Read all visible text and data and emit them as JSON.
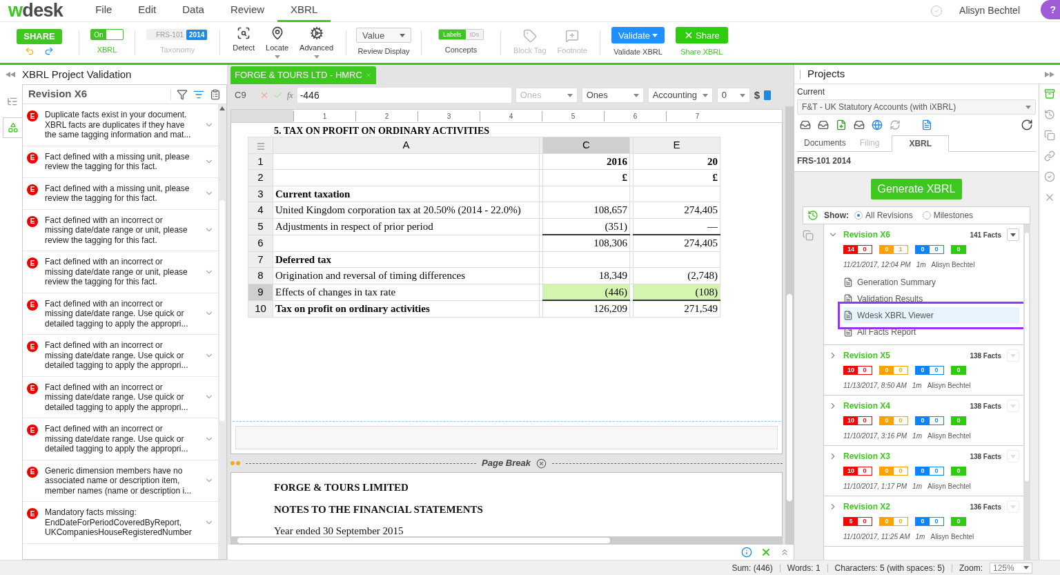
{
  "logo": {
    "accent": "w",
    "rest": "desk"
  },
  "menu": [
    {
      "label": "File",
      "selected": false
    },
    {
      "label": "Edit",
      "selected": false
    },
    {
      "label": "Data",
      "selected": false
    },
    {
      "label": "Review",
      "selected": false
    },
    {
      "label": "XBRL",
      "selected": true
    }
  ],
  "user": "Alisyn Bechtel",
  "help": "?",
  "toolbar": {
    "share": "SHARE",
    "xbrl_toggle": {
      "on": true,
      "text": "On",
      "label": "XBRL"
    },
    "taxonomy": {
      "name": "FRS-101",
      "year": "2014",
      "label": "Taxonomy"
    },
    "tools": [
      {
        "kind": "detect",
        "label": "Detect",
        "menu": false
      },
      {
        "kind": "locate",
        "label": "Locate",
        "menu": true
      },
      {
        "kind": "advanced",
        "label": "Advanced",
        "menu": true
      }
    ],
    "review_display": {
      "value": "Value",
      "label": "Review Display"
    },
    "concepts": {
      "options": [
        {
          "label": "Labels",
          "selected": true
        },
        {
          "label": "IDs",
          "selected": false
        }
      ],
      "label": "Concepts"
    },
    "tag_tools": [
      {
        "kind": "tag",
        "label": "Block Tag",
        "disabled": true
      },
      {
        "kind": "footnote",
        "label": "Footnote",
        "disabled": true
      }
    ],
    "validate": {
      "button": "Validate",
      "label": "Validate XBRL"
    },
    "share_xbrl": {
      "button": "Share",
      "label": "Share XBRL"
    }
  },
  "validation_panel": {
    "title": "XBRL Project Validation",
    "left_rail": [
      {
        "kind": "outline",
        "selected": false
      },
      {
        "kind": "shapes",
        "selected": true
      }
    ],
    "revision": "Revision X6",
    "issues": [
      {
        "severity": "E",
        "lines": [
          "Duplicate facts exist in your document.",
          "XBRL facts are duplicates if they have",
          "the same tagging information and mat..."
        ]
      },
      {
        "severity": "E",
        "lines": [
          "Fact defined with a missing unit, please",
          "review the tagging for this fact."
        ]
      },
      {
        "severity": "E",
        "lines": [
          "Fact defined with a missing unit, please",
          "review the tagging for this fact."
        ]
      },
      {
        "severity": "E",
        "lines": [
          "Fact defined with an incorrect or",
          "missing date/date range or unit, please",
          "review the tagging for this fact."
        ]
      },
      {
        "severity": "E",
        "lines": [
          "Fact defined with an incorrect or",
          "missing date/date range or unit, please",
          "review the tagging for this fact."
        ]
      },
      {
        "severity": "E",
        "lines": [
          "Fact defined with an incorrect or",
          "missing date/date range. Use quick or",
          "detailed tagging to apply the appropri..."
        ]
      },
      {
        "severity": "E",
        "lines": [
          "Fact defined with an incorrect or",
          "missing date/date range. Use quick or",
          "detailed tagging to apply the appropri..."
        ]
      },
      {
        "severity": "E",
        "lines": [
          "Fact defined with an incorrect or",
          "missing date/date range. Use quick or",
          "detailed tagging to apply the appropri..."
        ]
      },
      {
        "severity": "E",
        "lines": [
          "Fact defined with an incorrect or",
          "missing date/date range. Use quick or",
          "detailed tagging to apply the appropri..."
        ]
      },
      {
        "severity": "E",
        "lines": [
          "Generic dimension members have no",
          "associated name or description item,",
          "member names (name or description i..."
        ]
      },
      {
        "severity": "E",
        "lines": [
          "Mandatory facts missing:",
          "EndDateForPeriodCoveredByReport,",
          "UKCompaniesHouseRegisteredNumber"
        ]
      }
    ]
  },
  "document": {
    "tab": "FORGE & TOURS LTD - HMRC",
    "formula_bar": {
      "cell": "C9",
      "function_label": "fx",
      "value": "-446",
      "selects": [
        {
          "value": "Ones",
          "disabled": true
        },
        {
          "value": "Ones",
          "disabled": false
        },
        {
          "value": "Accounting",
          "disabled": false
        },
        {
          "value": "0",
          "disabled": false
        }
      ],
      "currency": "$"
    },
    "ruler": [
      "1",
      "2",
      "3",
      "4",
      "5",
      "6",
      "7"
    ],
    "heading": "5. TAX ON PROFIT ON ORDINARY ACTIVITIES",
    "columns": [
      {
        "kind": "wide",
        "label": "A",
        "selected": false
      },
      {
        "kind": "narrow"
      },
      {
        "kind": "wide",
        "label": "C",
        "selected": true
      },
      {
        "kind": "narrow"
      },
      {
        "kind": "wide",
        "label": "E",
        "selected": false
      }
    ],
    "rows": [
      {
        "num": "1",
        "selected": false,
        "values_bold": true,
        "c": "2016",
        "e": "20"
      },
      {
        "num": "2",
        "selected": false,
        "values_bold": true,
        "c": "£",
        "e": "£"
      },
      {
        "num": "3",
        "selected": false,
        "label_bold": true,
        "a": "Current taxation"
      },
      {
        "num": "4",
        "selected": false,
        "a": "United Kingdom corporation tax at 20.50% (2014 - 22.0%)",
        "c": "108,657",
        "e": "274,405"
      },
      {
        "num": "5",
        "selected": false,
        "a": "Adjustments in respect of prior period",
        "c": "(351)",
        "e": "—"
      },
      {
        "num": "6",
        "selected": false,
        "rule_above": true,
        "c": "108,306",
        "e": "274,405"
      },
      {
        "num": "7",
        "selected": false,
        "label_bold": true,
        "a": "Deferred tax"
      },
      {
        "num": "8",
        "selected": false,
        "a": "Origination and reversal of timing differences",
        "c": "18,349",
        "e": "(2,748)"
      },
      {
        "num": "9",
        "selected": true,
        "a": "Effects of changes in tax rate",
        "c": "(446)",
        "e": "(108)"
      },
      {
        "num": "10",
        "selected": false,
        "label_bold": true,
        "rule_above": true,
        "a": "Tax on profit on ordinary activities",
        "c": "126,209",
        "e": "271,549"
      }
    ],
    "page_break": "Page Break",
    "page2": [
      {
        "text": "FORGE & TOURS LIMITED",
        "bold": true
      },
      {
        "text": "NOTES TO THE FINANCIAL STATEMENTS",
        "bold": true
      },
      {
        "text": "Year ended 30 September 2015",
        "bold": false
      }
    ]
  },
  "status_bar": {
    "sum": "Sum: (446)",
    "words": "Words: 1",
    "characters": "Characters: 5 (with spaces: 5)",
    "zoom_label": "Zoom:",
    "zoom": "125%"
  },
  "projects": {
    "title": "Projects",
    "current_label": "Current",
    "project": "F&T - UK Statutory Accounts (with iXBRL)",
    "tabs": [
      {
        "label": "Documents",
        "selected": false,
        "disabled": false
      },
      {
        "label": "Filing",
        "selected": false,
        "disabled": true
      },
      {
        "label": "XBRL",
        "selected": true,
        "disabled": false
      }
    ],
    "taxonomy": "FRS-101 2014",
    "generate": "Generate XBRL",
    "show_label": "Show:",
    "show_options": [
      {
        "label": "All Revisions",
        "selected": true
      },
      {
        "label": "Milestones",
        "selected": false
      }
    ],
    "revisions": [
      {
        "name": "Revision X6",
        "facts": "141 Facts",
        "expanded": true,
        "counts": [
          {
            "color": "#ff0000",
            "values": [
              "14",
              "0"
            ]
          },
          {
            "color": "#ffa200",
            "values": [
              "0",
              "1"
            ]
          },
          {
            "color": "#0a84ff",
            "values": [
              "0",
              "0"
            ]
          },
          {
            "color": "#2ecc0e",
            "values": [
              "0"
            ]
          }
        ],
        "date": "11/21/2017, 12:04 PM",
        "duration": "1m",
        "author": "Alisyn Bechtel",
        "documents": [
          {
            "label": "Generation Summary",
            "highlighted": false
          },
          {
            "label": "Validation Results",
            "highlighted": false
          },
          {
            "label": "Wdesk XBRL Viewer",
            "highlighted": true
          },
          {
            "label": "All Facts Report",
            "highlighted": false
          }
        ]
      },
      {
        "name": "Revision X5",
        "facts": "138 Facts",
        "expanded": false,
        "counts": [
          {
            "color": "#ff0000",
            "values": [
              "10",
              "0"
            ]
          },
          {
            "color": "#ffa200",
            "values": [
              "0",
              "0"
            ]
          },
          {
            "color": "#0a84ff",
            "values": [
              "0",
              "0"
            ]
          },
          {
            "color": "#2ecc0e",
            "values": [
              "0"
            ]
          }
        ],
        "date": "11/13/2017, 8:50 AM",
        "duration": "1m",
        "author": "Alisyn Bechtel"
      },
      {
        "name": "Revision X4",
        "facts": "138 Facts",
        "expanded": false,
        "counts": [
          {
            "color": "#ff0000",
            "values": [
              "10",
              "0"
            ]
          },
          {
            "color": "#ffa200",
            "values": [
              "0",
              "0"
            ]
          },
          {
            "color": "#0a84ff",
            "values": [
              "0",
              "0"
            ]
          },
          {
            "color": "#2ecc0e",
            "values": [
              "0"
            ]
          }
        ],
        "date": "11/10/2017, 3:16 PM",
        "duration": "1m",
        "author": "Alisyn Bechtel"
      },
      {
        "name": "Revision X3",
        "facts": "138 Facts",
        "expanded": false,
        "counts": [
          {
            "color": "#ff0000",
            "values": [
              "10",
              "0"
            ]
          },
          {
            "color": "#ffa200",
            "values": [
              "0",
              "0"
            ]
          },
          {
            "color": "#0a84ff",
            "values": [
              "0",
              "0"
            ]
          },
          {
            "color": "#2ecc0e",
            "values": [
              "0"
            ]
          }
        ],
        "date": "11/10/2017, 1:17 PM",
        "duration": "1m",
        "author": "Alisyn Bechtel"
      },
      {
        "name": "Revision X2",
        "facts": "136 Facts",
        "expanded": false,
        "counts": [
          {
            "color": "#ff0000",
            "values": [
              "5",
              "0"
            ]
          },
          {
            "color": "#ffa200",
            "values": [
              "0",
              "0"
            ]
          },
          {
            "color": "#0a84ff",
            "values": [
              "0",
              "0"
            ]
          },
          {
            "color": "#2ecc0e",
            "values": [
              "0"
            ]
          }
        ],
        "date": "11/10/2017, 11:25 AM",
        "duration": "1m",
        "author": "Alisyn Bechtel"
      }
    ],
    "right_rail": [
      {
        "kind": "box",
        "selected": true
      },
      {
        "kind": "history",
        "selected": false
      },
      {
        "kind": "copy",
        "selected": false
      },
      {
        "kind": "link",
        "selected": false
      },
      {
        "kind": "check",
        "selected": false
      },
      {
        "kind": "xbrl",
        "selected": false
      }
    ]
  }
}
